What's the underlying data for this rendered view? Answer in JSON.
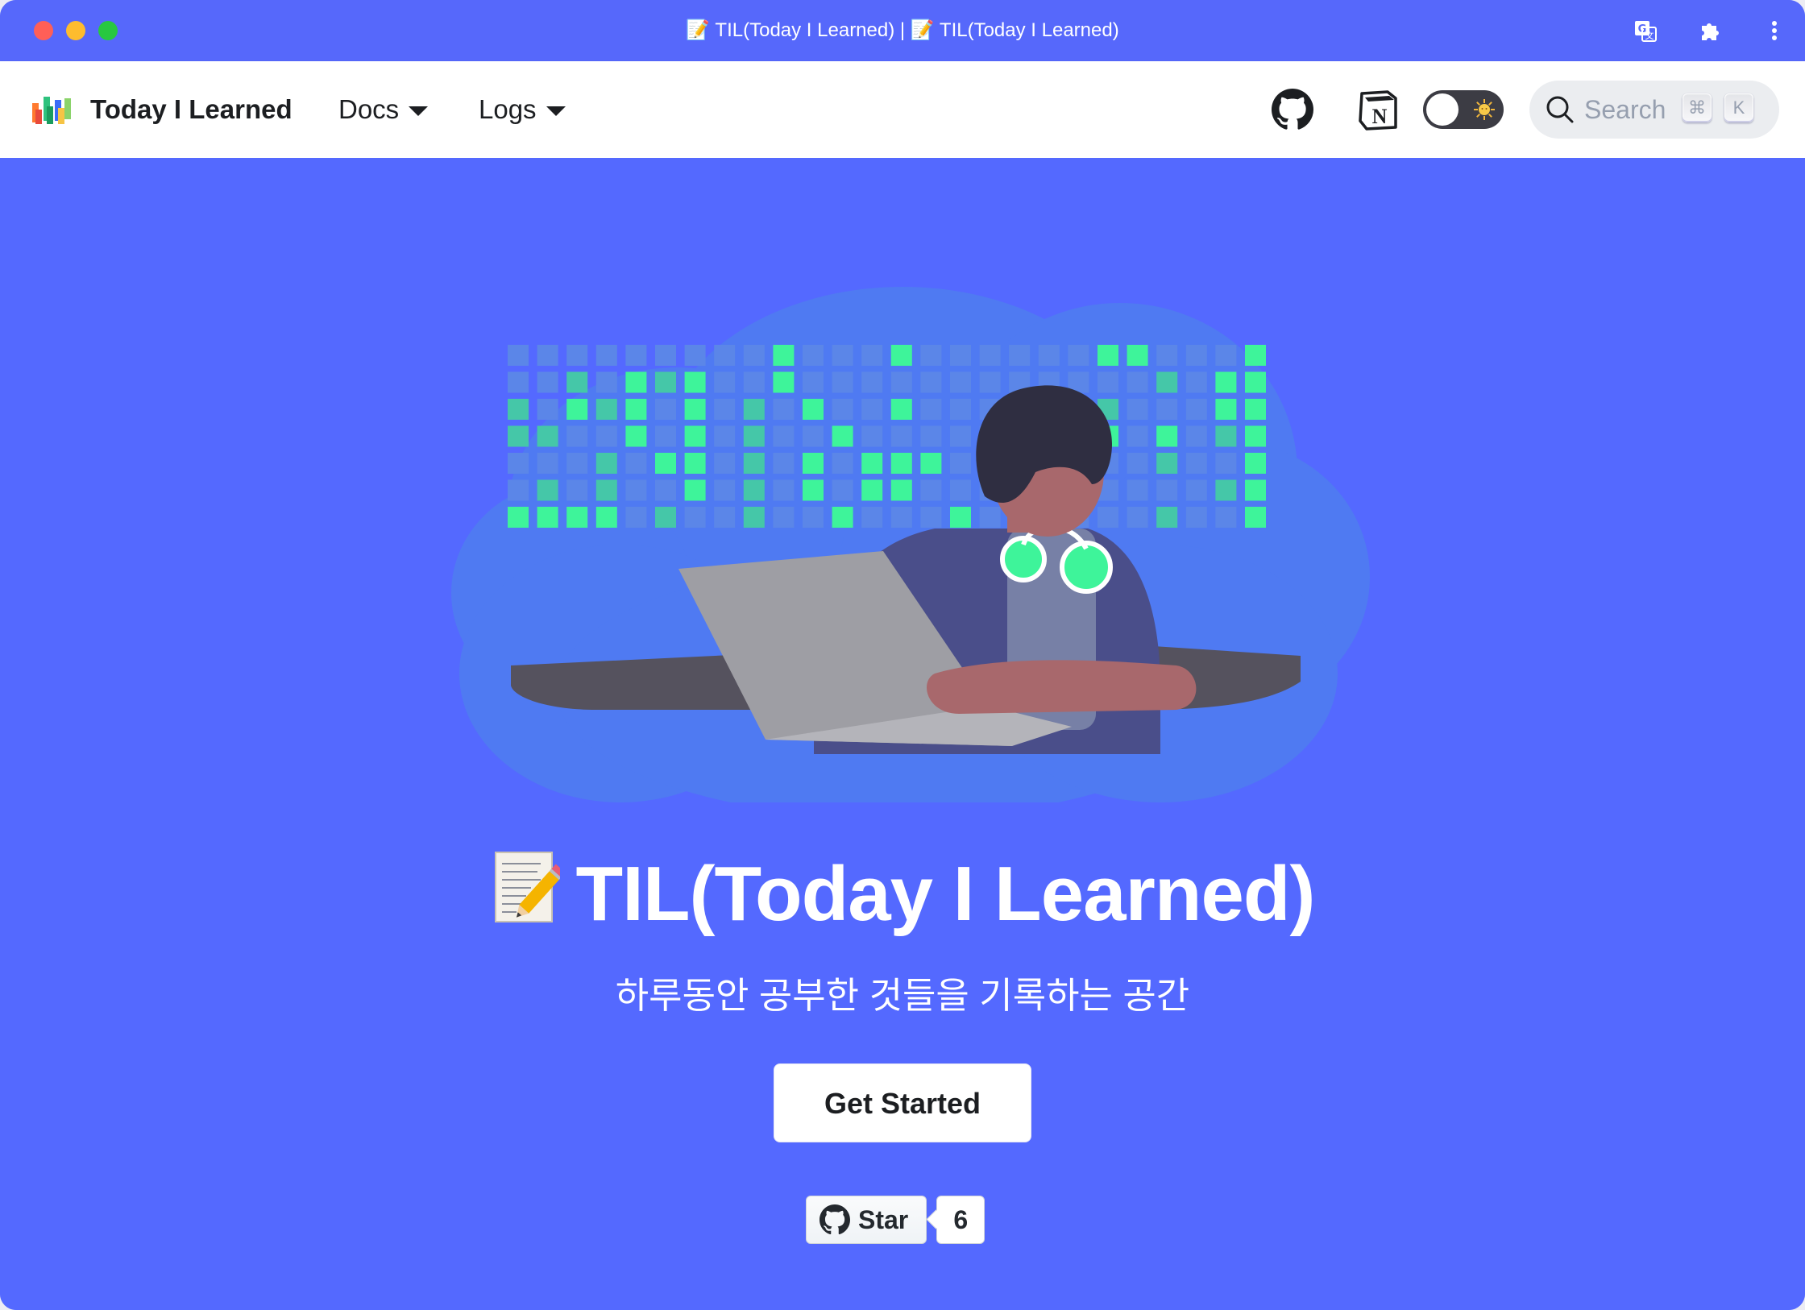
{
  "browser": {
    "tab_title": "📝 TIL(Today I Learned) | 📝 TIL(Today I Learned)",
    "icons": [
      "translate-icon",
      "extensions-puzzle-icon",
      "more-vert-icon"
    ]
  },
  "navbar": {
    "brand_title": "Today I Learned",
    "links": [
      {
        "label": "Docs",
        "has_dropdown": true
      },
      {
        "label": "Logs",
        "has_dropdown": true
      }
    ],
    "icons": [
      "github-icon",
      "notion-icon"
    ],
    "theme_toggle": {
      "state": "light",
      "icon": "sun-icon"
    },
    "search": {
      "placeholder": "Search",
      "shortcut_keys": [
        "⌘",
        "K"
      ]
    }
  },
  "hero": {
    "title": "TIL(Today I Learned)",
    "title_emoji": "memo-icon",
    "subtitle": "하루동안 공부한 것들을 기록하는 공간",
    "cta_label": "Get Started",
    "github_star": {
      "label": "Star",
      "count": "6"
    }
  },
  "colors": {
    "hero_background": "#5469ff",
    "titlebar_background": "#5668fb",
    "navbar_background": "#ffffff",
    "accent_green": "#3ef49a",
    "cloud_blue": "#4f7af2"
  }
}
